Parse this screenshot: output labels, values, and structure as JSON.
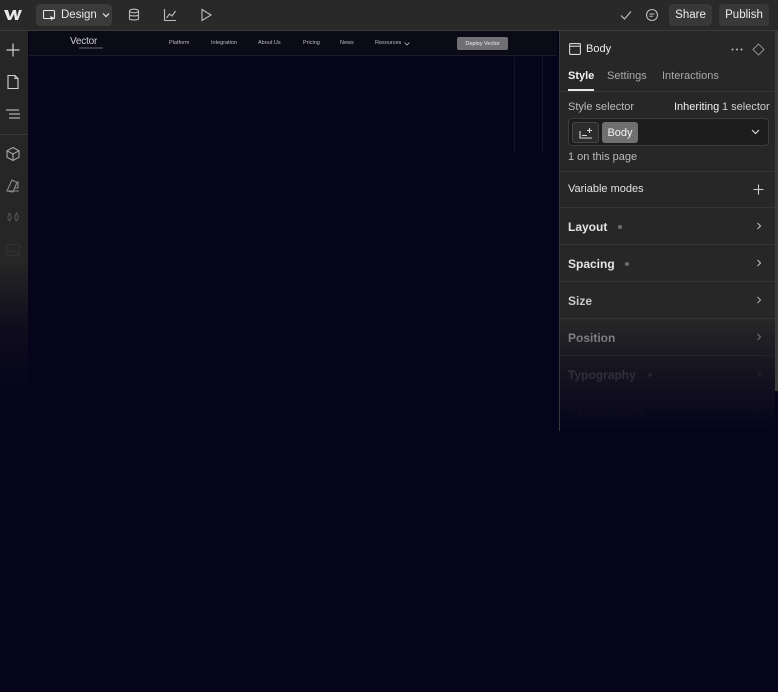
{
  "toolbar": {
    "mode_label": "Design",
    "share_label": "Share",
    "publish_label": "Publish"
  },
  "canvas": {
    "site_logo": "Vector",
    "nav_links": [
      "Platform",
      "Integration",
      "About Us",
      "Pricing",
      "News",
      "Resources"
    ],
    "deploy_label": "Deploy Vector"
  },
  "panel": {
    "title": "Body",
    "tabs": [
      "Style",
      "Settings",
      "Interactions"
    ],
    "active_tab": "Style",
    "style_selector_label": "Style selector",
    "inheriting_label": "Inheriting",
    "inheriting_count": "1 selector",
    "selector_chip": "Body",
    "on_page_text": "1 on this page",
    "variable_modes_label": "Variable modes",
    "sections": [
      "Layout",
      "Spacing",
      "Size",
      "Position",
      "Typography",
      "Backgrounds"
    ]
  },
  "colors": {
    "canvas_bg": "#06041a",
    "panel_bg": "#272727",
    "toolbar_bg": "#292929"
  },
  "icons": {
    "logo": "webflow-logo",
    "toolbar": [
      "cms-icon",
      "analytics-icon",
      "preview-icon",
      "check-icon",
      "comment-icon"
    ],
    "rail": [
      "add-icon",
      "pages-icon",
      "navigator-icon",
      "components-icon",
      "style-manager-icon",
      "variables-icon",
      "assets-icon"
    ]
  }
}
